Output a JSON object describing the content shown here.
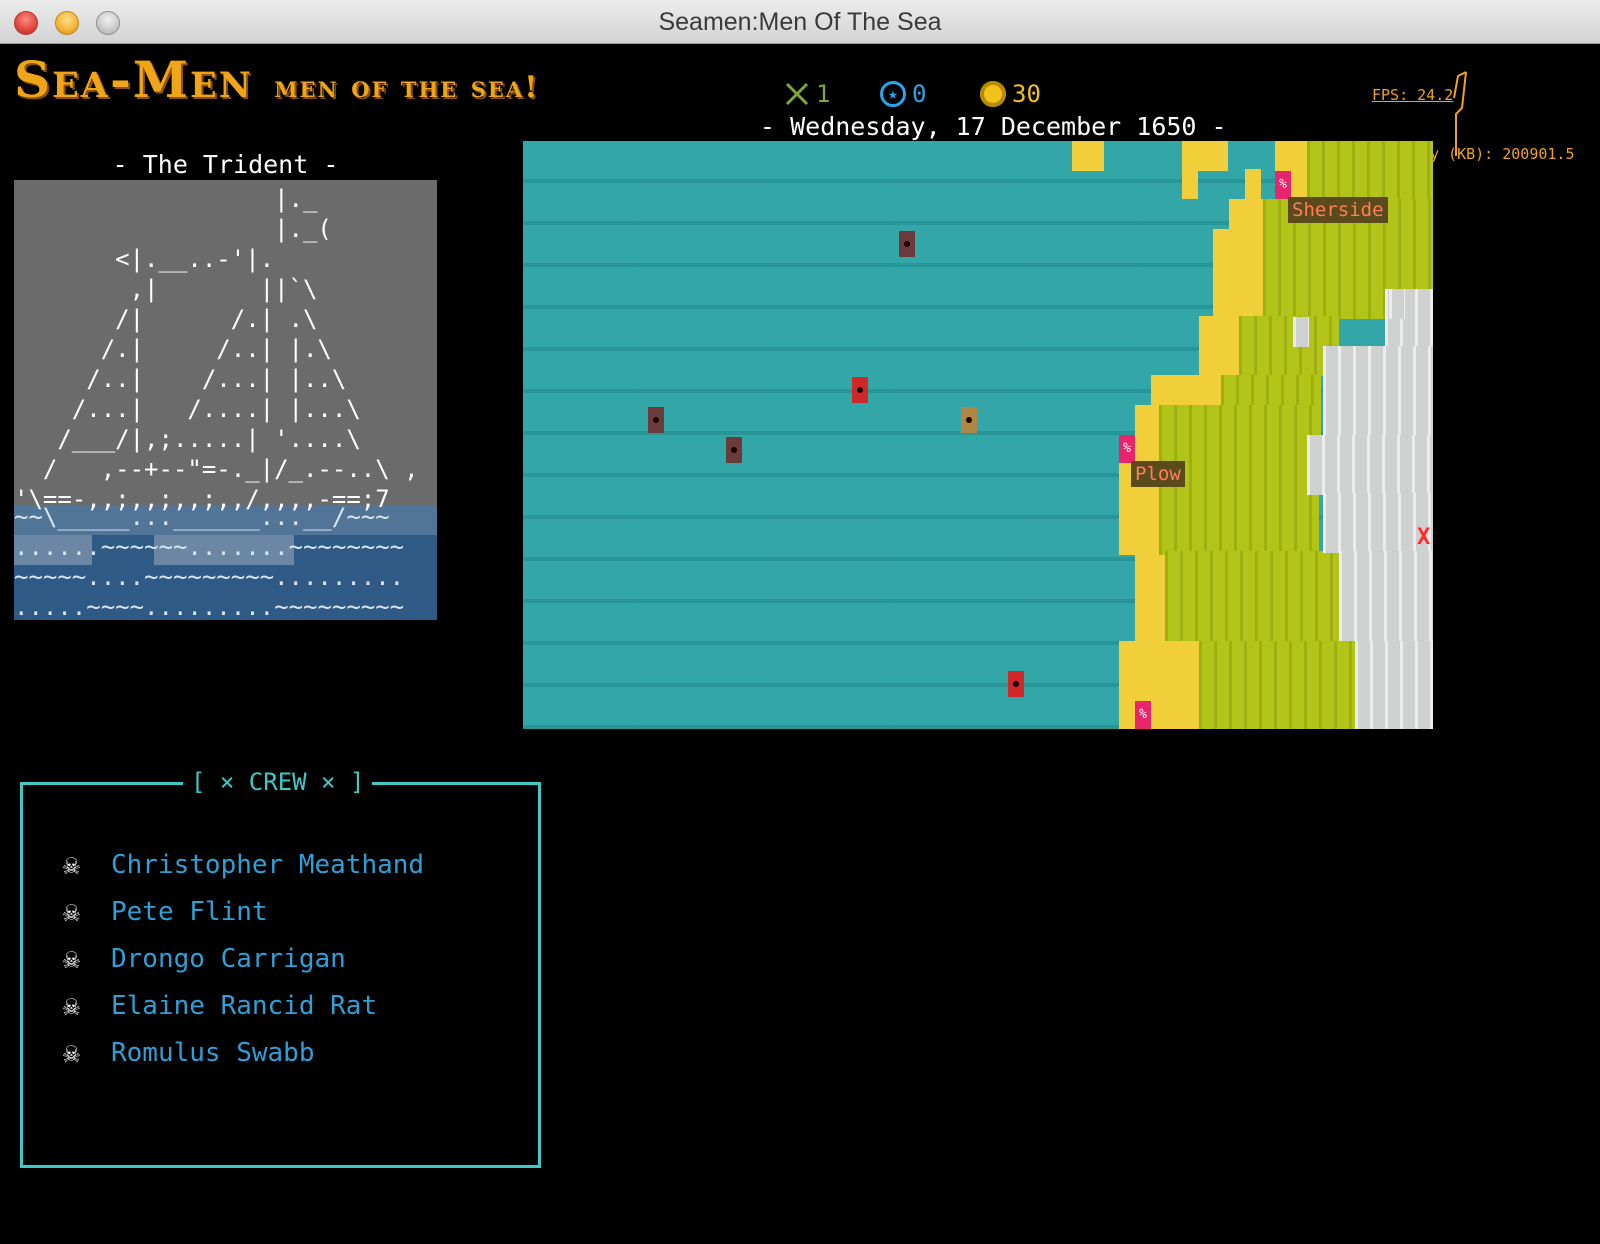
{
  "window": {
    "title": "Seamen:Men Of The Sea"
  },
  "logo": {
    "main": "Sea-Men",
    "sub": "men of the sea!"
  },
  "stats": {
    "swords": {
      "icon": "crossed-swords-icon",
      "value": "1",
      "color": "#7fa83a"
    },
    "reputation": {
      "icon": "star-circle-icon",
      "value": "0",
      "color": "#27a6e8"
    },
    "gold": {
      "icon": "gold-coin-icon",
      "value": "30",
      "color": "#f2c21a"
    }
  },
  "date": "- Wednesday, 17 December 1650 -",
  "perf": {
    "fps": "FPS: 24.2",
    "memory": "y (KB): 200901.5"
  },
  "ship": {
    "name": "- The Trident -"
  },
  "map": {
    "towns": [
      {
        "name": "Sherside"
      },
      {
        "name": "Plow"
      }
    ],
    "town_glyph": "%",
    "marker": "X"
  },
  "crew": {
    "title": "[ × CREW × ]",
    "members": [
      "Christopher Meathand",
      "Pete Flint",
      "Drongo Carrigan",
      "Elaine Rancid Rat",
      "Romulus Swabb"
    ],
    "icon": "☠"
  }
}
